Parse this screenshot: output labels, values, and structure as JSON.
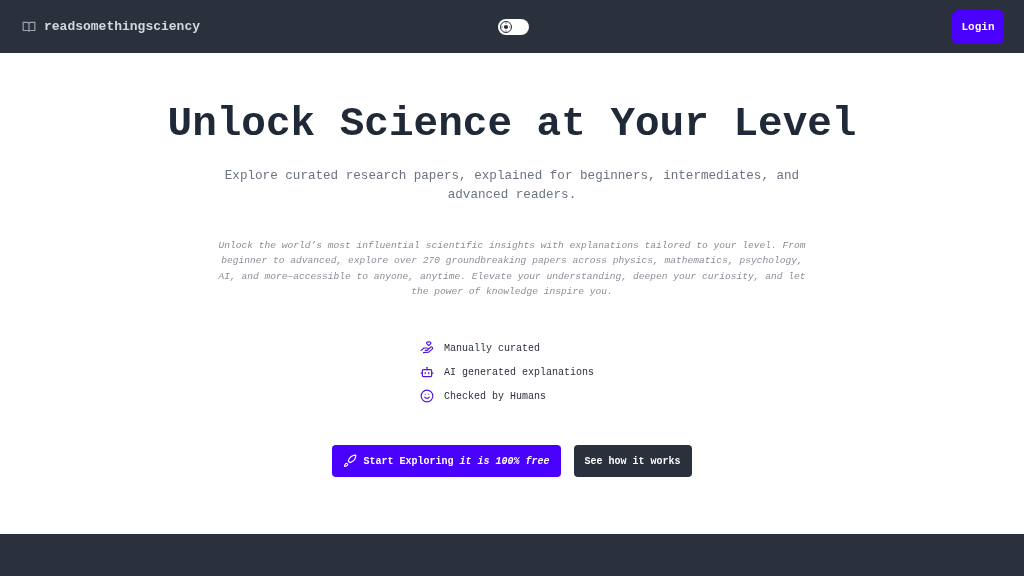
{
  "header": {
    "brand": "readsomethingsciency",
    "theme_toggle": {
      "on": false
    },
    "login_button": "Login"
  },
  "hero": {
    "title": "Unlock Science at Your Level",
    "subtitle": "Explore curated research papers, explained for beginners, intermediates, and advanced readers.",
    "description": "Unlock the world’s most influential scientific insights with explanations tailored to your level. From beginner to advanced, explore over 270 groundbreaking papers across physics, mathematics, psychology, AI, and more—accessible to anyone, anytime. Elevate your understanding, deepen your curiosity, and let the power of knowledge inspire you.",
    "features": [
      {
        "kind": "hand",
        "label": "Manually curated"
      },
      {
        "kind": "robot",
        "label": "AI generated explanations"
      },
      {
        "kind": "smile",
        "label": "Checked by Humans"
      }
    ],
    "primary_button": "Start Exploring *it is 100% free*",
    "secondary_button": "See how it works"
  }
}
